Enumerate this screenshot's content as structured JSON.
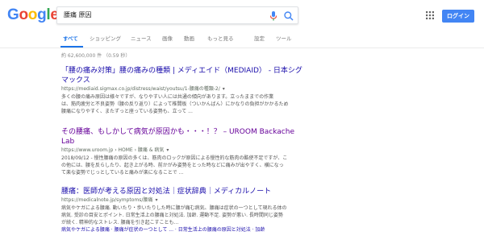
{
  "logo": {
    "letters": [
      "G",
      "o",
      "o",
      "g",
      "l",
      "e"
    ],
    "colors": [
      "#4285f4",
      "#ea4335",
      "#fbbc05",
      "#4285f4",
      "#34a853",
      "#ea4335"
    ]
  },
  "search": {
    "query": "腰痛 原因"
  },
  "header": {
    "login_label": "ログイン"
  },
  "tabs": [
    {
      "label": "すべて",
      "active": true
    },
    {
      "label": "ショッピング"
    },
    {
      "label": "ニュース"
    },
    {
      "label": "画像"
    },
    {
      "label": "動画"
    },
    {
      "label": "もっと見る"
    },
    {
      "label": "設定"
    },
    {
      "label": "ツール"
    }
  ],
  "stats": "約 62,600,000 件 （0.59 秒）",
  "results": [
    {
      "title_line1": "「腰の痛み対策」腰の痛みの種類 | メディエイド（MEDIAID） - 日本シグ",
      "title_line2": "マックス",
      "url": "https://mediaid.sigmax.co.jp/distress/waist/youtsu/1-腰痛の種類-2/",
      "snippet_line1": "多くの腰の痛み原因は様々ですが、なりやすい人には共通の傾向があります。立ったままでの作業",
      "snippet_line2": "は、筋肉疲労と不良姿勢（腰の反り返り）によって椎間板（ついかんばん）にかなりの負担がかかるため",
      "snippet_line3": "腰痛になりやすく、またずっと座っている姿勢も、立って ..."
    },
    {
      "title_line1": "その腰痛、もしかして病気が原因かも・・・！？ – UROOM Backache",
      "title_line2": "Lab",
      "url": "https://www.uroom.jp › HOME › 腰痛 & 病気",
      "snippet_line1": "2018/09/12 - 慢性腰痛の原因の多くは、筋肉のロックが原因による慢性的な筋肉の酷使不足ですが、こ",
      "snippet_line2": "の他には、腰を反らしたり、起き上がる時、前かがみ姿勢をとった時などに痛みが出やすく、横になっ",
      "snippet_line3": "て楽な姿勢でじっとしていると痛みが楽になることで ..."
    },
    {
      "title_line1": "腰痛：医師が考える原因と対処法｜症状辞典｜メディカルノート",
      "url": "https://medicalnote.jp/symptoms/腰痛",
      "snippet_line1": "病気やケガによる腰痛. 動いたり・歩いたりした時に腰が痛む病気、腰痛は症状の一つとして現れる体の",
      "snippet_line2": "病気. 受診の目安とポイント. 日常生活上の腰痛と対処法. 加齢. 運動不足. 姿勢が悪い. 長時間同じ姿勢",
      "snippet_line3": "が続く. 精神的なストレス. 腰痛を引き起こすことも...",
      "links": "病気やケガによる腰痛 · 腰痛が症状の一つとして ... · 日常生活上の腰痛の原因と対処法 · 加齢"
    }
  ]
}
